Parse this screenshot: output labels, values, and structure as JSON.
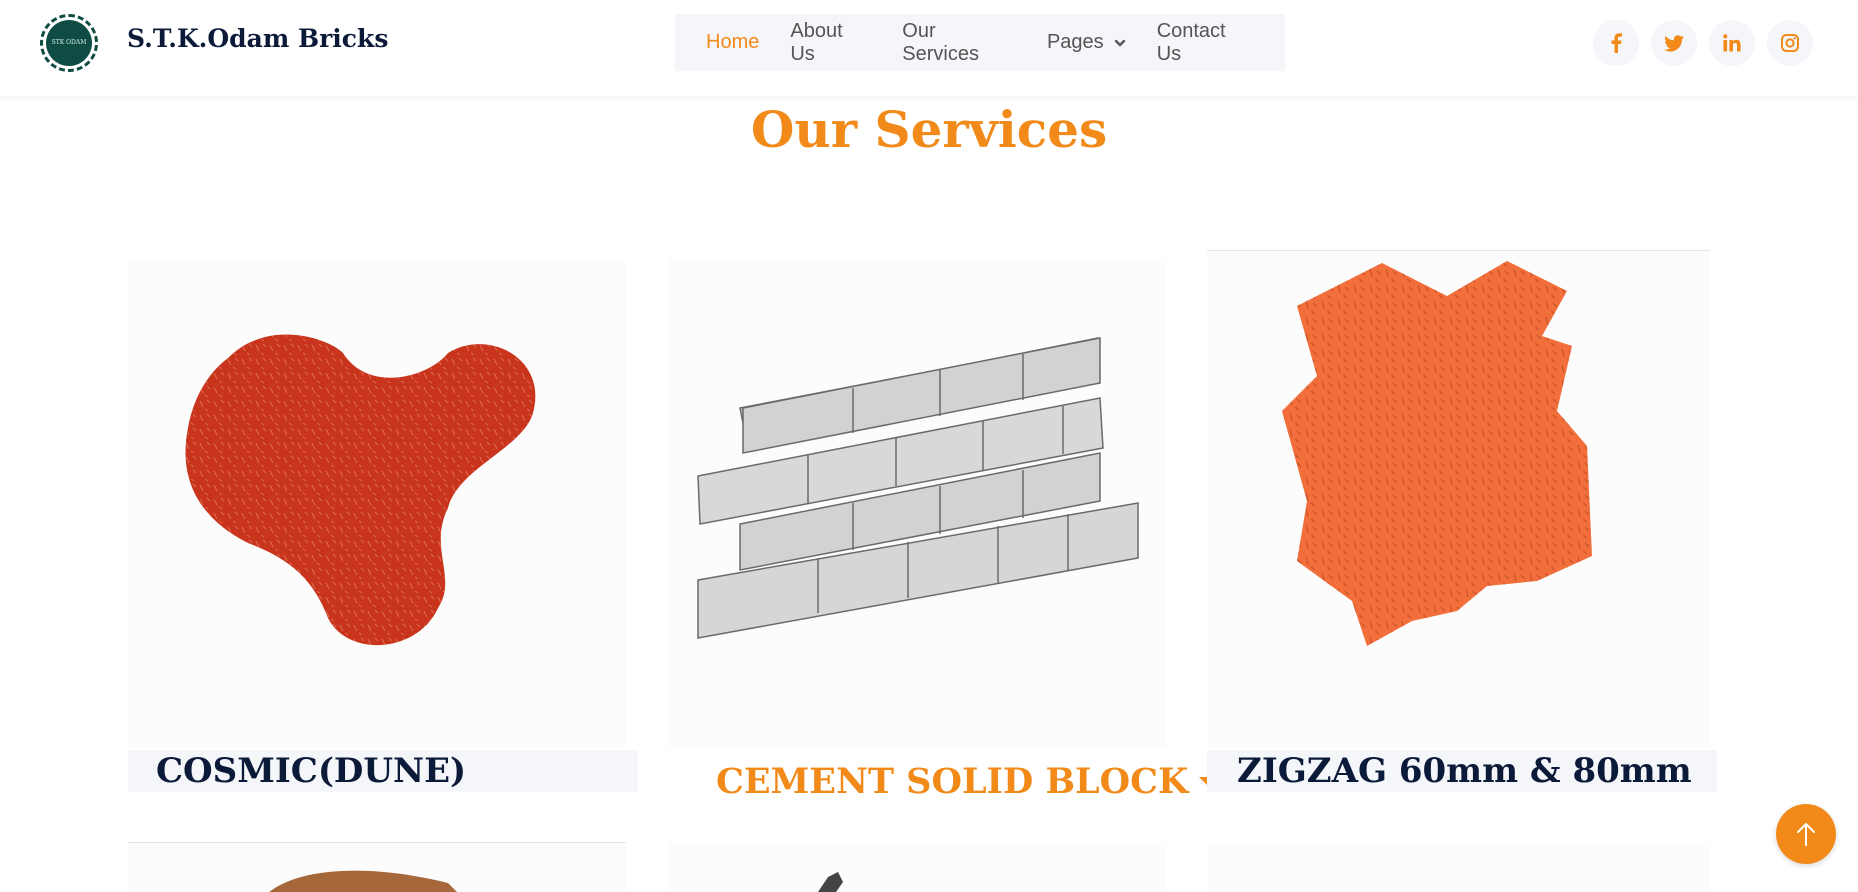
{
  "header": {
    "brand": "S.T.K.Odam Bricks",
    "logo_text": "STK ODAM",
    "nav": [
      {
        "label": "Home"
      },
      {
        "label": "About Us"
      },
      {
        "label": "Our Services"
      },
      {
        "label": "Pages"
      },
      {
        "label": "Contact Us"
      }
    ],
    "active_nav": "Home",
    "socials": [
      "facebook-icon",
      "twitter-icon",
      "linkedin-icon",
      "instagram-icon"
    ]
  },
  "section": {
    "title": "Our Services"
  },
  "cards": [
    {
      "label": "COSMIC(DUNE)"
    },
    {
      "label": "CEMENT SOLID BLOCK"
    },
    {
      "label": "ZIGZAG 60mm & 80mm"
    }
  ],
  "colors": {
    "accent": "#f28a1a",
    "dark": "#0c1a3a",
    "logo": "#0f4d44",
    "nav_bg": "#f4f6f9"
  }
}
